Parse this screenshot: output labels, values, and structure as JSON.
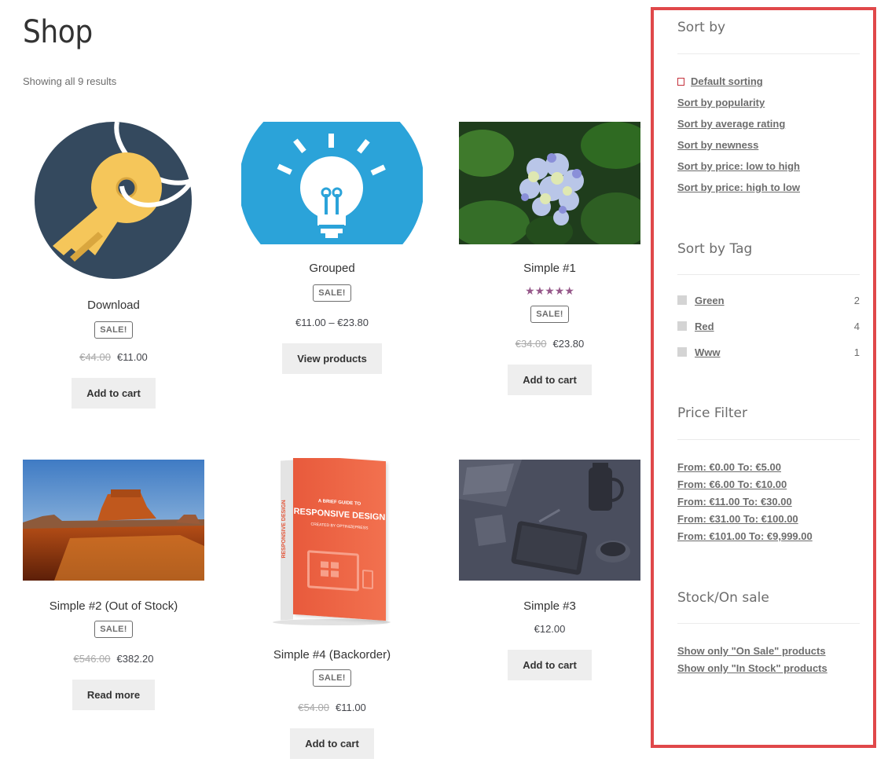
{
  "page": {
    "title": "Shop",
    "result_count": "Showing all 9 results"
  },
  "products": [
    {
      "name": "Download",
      "badge": "SALE!",
      "old_price": "€44.00",
      "price": "€11.00",
      "button": "Add to cart"
    },
    {
      "name": "Grouped",
      "badge": "SALE!",
      "price": "€11.00 – €23.80",
      "button": "View products"
    },
    {
      "name": "Simple #1",
      "rating": "★★★★★",
      "badge": "SALE!",
      "old_price": "€34.00",
      "price": "€23.80",
      "button": "Add to cart"
    },
    {
      "name": "Simple #2 (Out of Stock)",
      "badge": "SALE!",
      "old_price": "€546.00",
      "price": "€382.20",
      "button": "Read more"
    },
    {
      "name": "Simple #4 (Backorder)",
      "badge": "SALE!",
      "old_price": "€54.00",
      "price": "€11.00",
      "button": "Add to cart",
      "book_line1": "A BRIEF GUIDE TO",
      "book_line2": "RESPONSIVE DESIGN",
      "book_line3": "CREATED BY OPTINIZEPRESS",
      "book_spine": "RESPONSIVE DESIGN"
    },
    {
      "name": "Simple #3",
      "price": "€12.00",
      "button": "Add to cart"
    }
  ],
  "sidebar": {
    "sort_by": {
      "title": "Sort by",
      "items": [
        "Default sorting",
        "Sort by popularity",
        "Sort by average rating",
        "Sort by newness",
        "Sort by price: low to high",
        "Sort by price: high to low"
      ]
    },
    "sort_by_tag": {
      "title": "Sort by Tag",
      "tags": [
        {
          "label": "Green",
          "count": "2"
        },
        {
          "label": "Red",
          "count": "4"
        },
        {
          "label": "Www",
          "count": "1"
        }
      ]
    },
    "price_filter": {
      "title": "Price Filter",
      "ranges": [
        "From: €0.00 To: €5.00",
        "From: €6.00 To: €10.00",
        "From: €11.00 To: €30.00",
        "From: €31.00 To: €100.00",
        "From: €101.00 To: €9,999.00"
      ]
    },
    "stock": {
      "title": "Stock/On sale",
      "links": [
        "Show only \"On Sale\" products",
        "Show only \"In Stock\" products"
      ]
    }
  },
  "colors": {
    "highlight_border": "#e0484a",
    "rating": "#96588a",
    "button_bg": "#eeeeee"
  }
}
